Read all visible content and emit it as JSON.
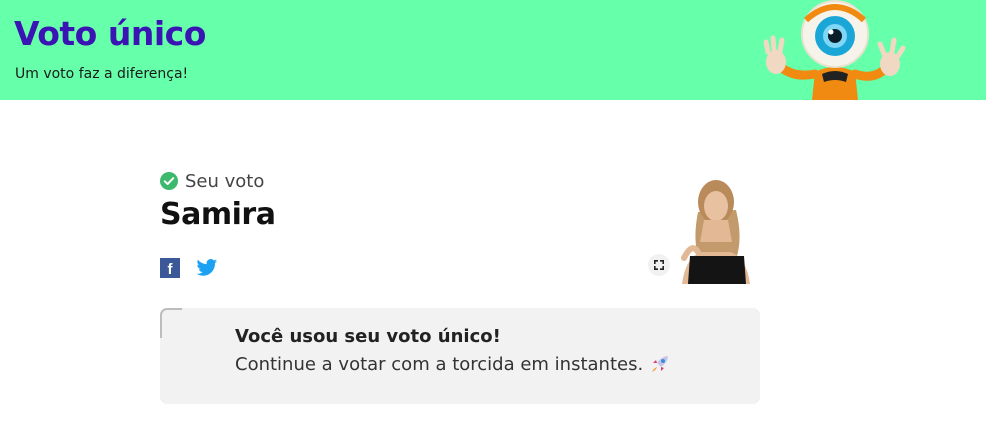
{
  "header": {
    "title": "Voto único",
    "subtitle": "Um voto faz a diferença!",
    "mascot_icon": "big-brother-eye-mascot",
    "background": "#66ffaa",
    "title_color": "#3b14b4"
  },
  "vote": {
    "label": "Seu voto",
    "candidate": "Samira",
    "check_icon": "check-circle-icon",
    "check_color": "#3cb96c"
  },
  "share": {
    "facebook_glyph": "f",
    "facebook_icon": "facebook-icon",
    "twitter_icon": "twitter-icon"
  },
  "notice": {
    "title": "Você usou seu voto único!",
    "text": "Continue a votar com a torcida em instantes.",
    "emoji_icon": "rocket-icon"
  }
}
